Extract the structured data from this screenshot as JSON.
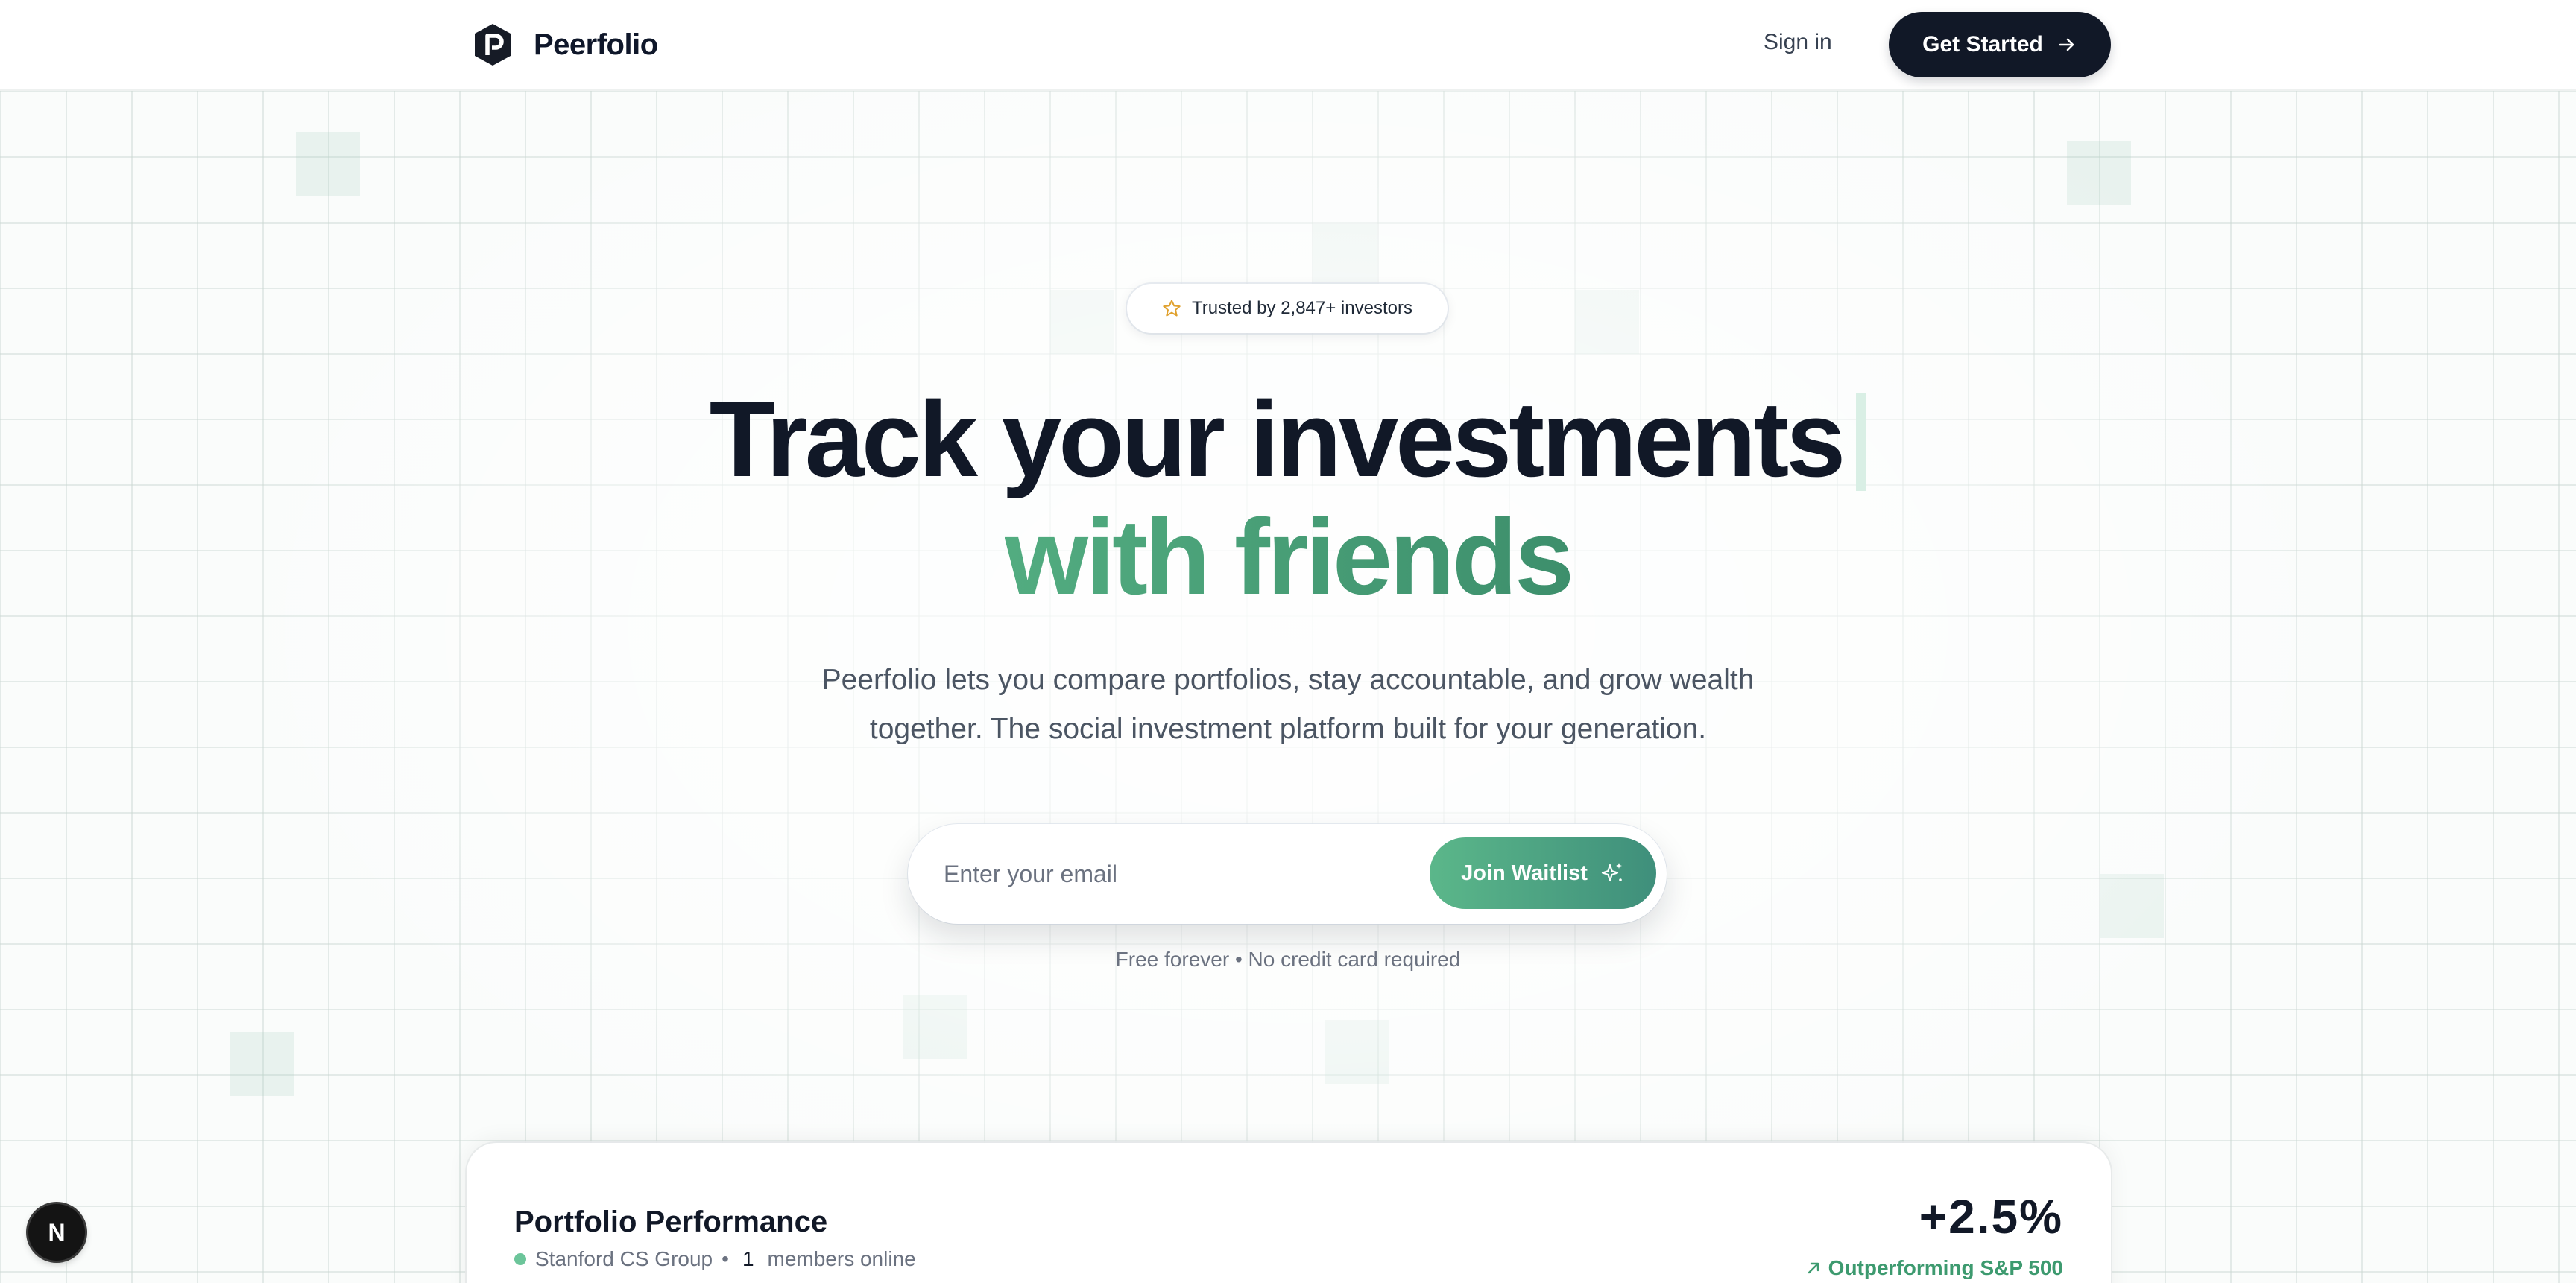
{
  "header": {
    "brand_name": "Peerfolio",
    "logo_icon": "peerfolio-logo-icon",
    "signin_label": "Sign in",
    "get_started_label": "Get Started"
  },
  "hero": {
    "trust_badge": "Trusted by 2,847+ investors",
    "headline_line1": "Track your investments",
    "headline_line2": "with friends",
    "subtitle": "Peerfolio lets you compare portfolios, stay accountable, and grow wealth together. The social investment platform built for your generation."
  },
  "waitlist": {
    "email_placeholder": "Enter your email",
    "email_value": "",
    "join_label": "Join Waitlist",
    "fineprint": "Free forever • No credit card required"
  },
  "card": {
    "title": "Portfolio Performance",
    "group_name": "Stanford CS Group",
    "separator": "•",
    "members_count": "1",
    "members_label": "members online",
    "change": "+2.5%",
    "outperform_label": "Outperforming S&P 500"
  },
  "floating_badge": {
    "label": "N"
  },
  "colors": {
    "brand_dark": "#111827",
    "accent_green": "#4a9d79",
    "button_gradient_start": "#5bb78a",
    "button_gradient_end": "#3f8f7b",
    "online_dot": "#6cc59a"
  }
}
